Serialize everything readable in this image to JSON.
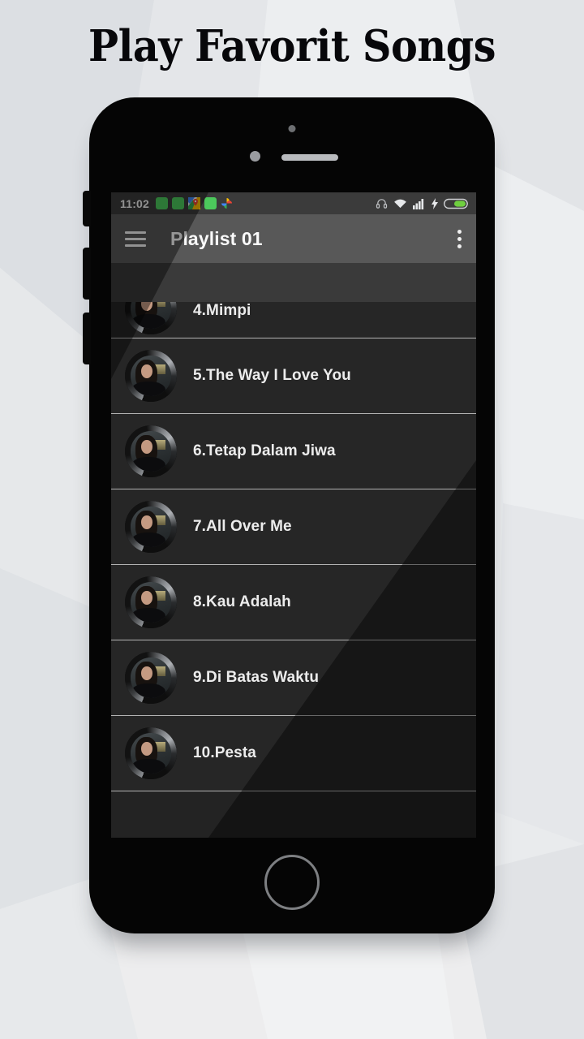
{
  "hero": {
    "title": "Play Favorit Songs"
  },
  "phone": {
    "hardware": {
      "camera": "camera-dot",
      "sensor": "proximity-sensor",
      "earpiece": "earpiece-speaker",
      "home": "home-button",
      "mute_switch": "mute-switch",
      "volume_up": "volume-up-button",
      "volume_down": "volume-down-button"
    }
  },
  "statusbar": {
    "time": "11:02",
    "left_icons": [
      {
        "name": "notification-app-icon-1",
        "kind": "green-square"
      },
      {
        "name": "notification-app-icon-2",
        "kind": "green-square"
      },
      {
        "name": "maps-icon",
        "kind": "maps"
      },
      {
        "name": "notification-app-icon-3",
        "kind": "green-square"
      },
      {
        "name": "photos-icon",
        "kind": "photos"
      }
    ],
    "right_icons": [
      {
        "name": "headphones-icon"
      },
      {
        "name": "wifi-icon"
      },
      {
        "name": "cellular-signal-icon"
      },
      {
        "name": "charging-bolt-icon"
      },
      {
        "name": "battery-icon"
      }
    ],
    "colors": {
      "background": "#3b3b3b",
      "text": "#f2f2f2",
      "battery_fill": "#6fcf3f"
    }
  },
  "appbar": {
    "menu_icon": "hamburger-menu-icon",
    "title": "Playlist 01",
    "overflow_icon": "more-vertical-icon",
    "background": "#585858"
  },
  "playlist": {
    "songs": [
      {
        "label": "4.Mimpi"
      },
      {
        "label": "5.The Way I Love You"
      },
      {
        "label": "6.Tetap Dalam Jiwa"
      },
      {
        "label": "7.All Over Me"
      },
      {
        "label": "8.Kau Adalah"
      },
      {
        "label": "9.Di Batas Waktu"
      },
      {
        "label": "10.Pesta"
      }
    ],
    "colors": {
      "row_background": "#262626",
      "divider": "#b2b2b2",
      "title_text": "#ececec"
    }
  },
  "theme": {
    "page_background": "#e9ebed",
    "phone_body": "#050505",
    "screen_background": "#232323",
    "hero_text": "#07070a"
  }
}
